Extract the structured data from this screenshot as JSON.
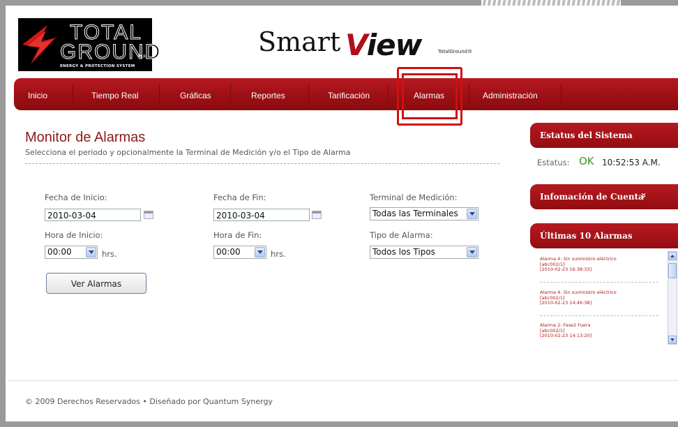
{
  "header": {
    "logo_line1": "TOTAL",
    "logo_line2": "GROUND",
    "logo_mark": "M.R",
    "logo_tagline": "ENERGY & PROTECTION SYSTEM",
    "brand_smart": "Smart",
    "brand_view_v": "V",
    "brand_view_rest": "iew",
    "brand_small": "TotalGround®"
  },
  "nav": {
    "items": [
      {
        "label": "Inicio"
      },
      {
        "label": "Tiempo Real"
      },
      {
        "label": "Gráficas"
      },
      {
        "label": "Reportes"
      },
      {
        "label": "Tarificación"
      },
      {
        "label": "Alarmas"
      },
      {
        "label": "Administración"
      }
    ],
    "active": "Alarmas"
  },
  "main": {
    "title": "Monitor de Alarmas",
    "subtitle": "Selecciona el periodo y opcionalmente la Terminal de Medición y/o el Tipo de Alarma",
    "fecha_inicio_label": "Fecha de Inicio:",
    "fecha_inicio_value": "2010-03-04",
    "fecha_fin_label": "Fecha de Fin:",
    "fecha_fin_value": "2010-03-04",
    "terminal_label": "Terminal de Medición:",
    "terminal_value": "Todas las Terminales",
    "hora_inicio_label": "Hora de Inicio:",
    "hora_inicio_value": "00:00",
    "hora_fin_label": "Hora de Fin:",
    "hora_fin_value": "00:00",
    "hrs": "hrs.",
    "tipo_label": "Tipo de Alarma:",
    "tipo_value": "Todos los Tipos",
    "button_label": "Ver Alarmas"
  },
  "sidebar": {
    "status_title": "Estatus del Sistema",
    "status_label": "Estatus:",
    "status_value": "OK",
    "status_time": "10:52:53 A.M.",
    "account_title": "Infomación de Cuenta",
    "account_chevron": "»",
    "alarms_title": "Últimas 10 Alarmas",
    "alarms": [
      {
        "line1": "Alarma 4: Sin suministro eléctrico",
        "line2": "[abc002/1]",
        "line3": "[2010-02-23 16:38:33]"
      },
      {
        "line1": "Alarma 4: Sin suministro eléctrico",
        "line2": "[abc002/1]",
        "line3": "[2010-02-23 14:46:38]"
      },
      {
        "line1": "Alarma 2: Fase2 Fuera",
        "line2": "[abc002/1]",
        "line3": "[2010-02-23 14:13:20]"
      }
    ]
  },
  "footer": {
    "text": "© 2009 Derechos Reservados • Diseñado por Quantum Synergy"
  },
  "colors": {
    "brand_red": "#b71920",
    "title_red": "#8b1a1a",
    "ok_green": "#3a9a20"
  }
}
